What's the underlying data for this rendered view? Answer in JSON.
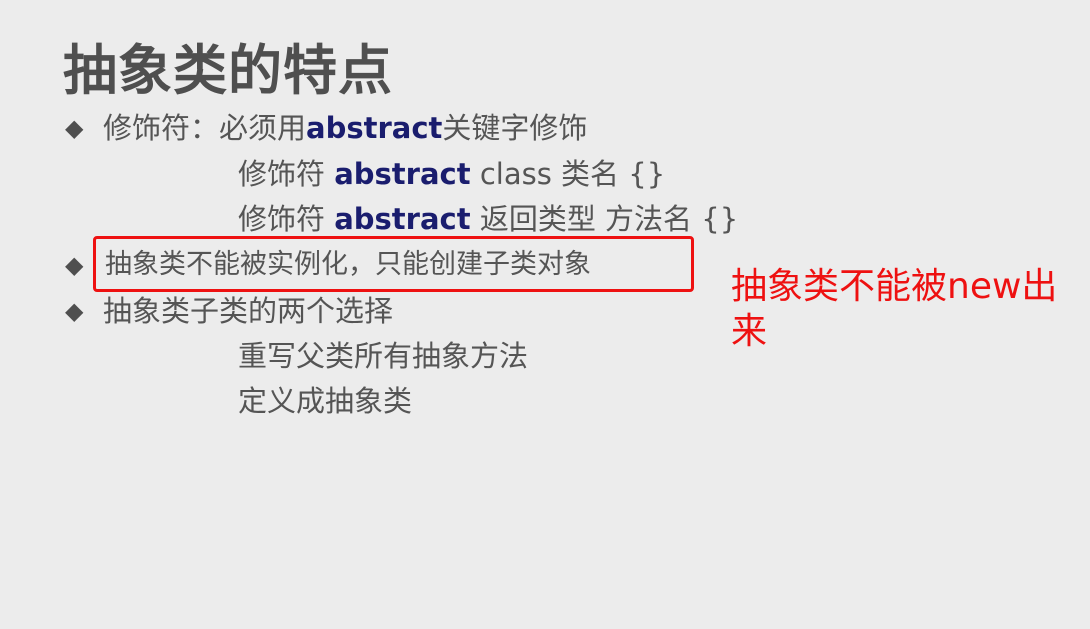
{
  "slide": {
    "title": "抽象类的特点",
    "bullet_symbol": "◆",
    "items": [
      {
        "pre": "修饰符：必须用",
        "keyword": "abstract",
        "post": "关键字修饰",
        "sub": [
          {
            "pre": "修饰符 ",
            "keyword": "abstract",
            "post": " class 类名 {}"
          },
          {
            "pre": "修饰符 ",
            "keyword": "abstract",
            "post": " 返回类型 方法名 {}"
          }
        ]
      },
      {
        "text": "抽象类不能被实例化，只能创建子类对象"
      },
      {
        "text": "抽象类子类的两个选择",
        "sub": [
          {
            "text": "重写父类所有抽象方法"
          },
          {
            "text": "定义成抽象类"
          }
        ]
      }
    ]
  },
  "annotation": {
    "text": "抽象类不能被new出来",
    "color": "#ee1111"
  },
  "colors": {
    "background": "#ececec",
    "text": "#555555",
    "keyword": "#1a1d6e",
    "highlight": "#ee1111"
  }
}
